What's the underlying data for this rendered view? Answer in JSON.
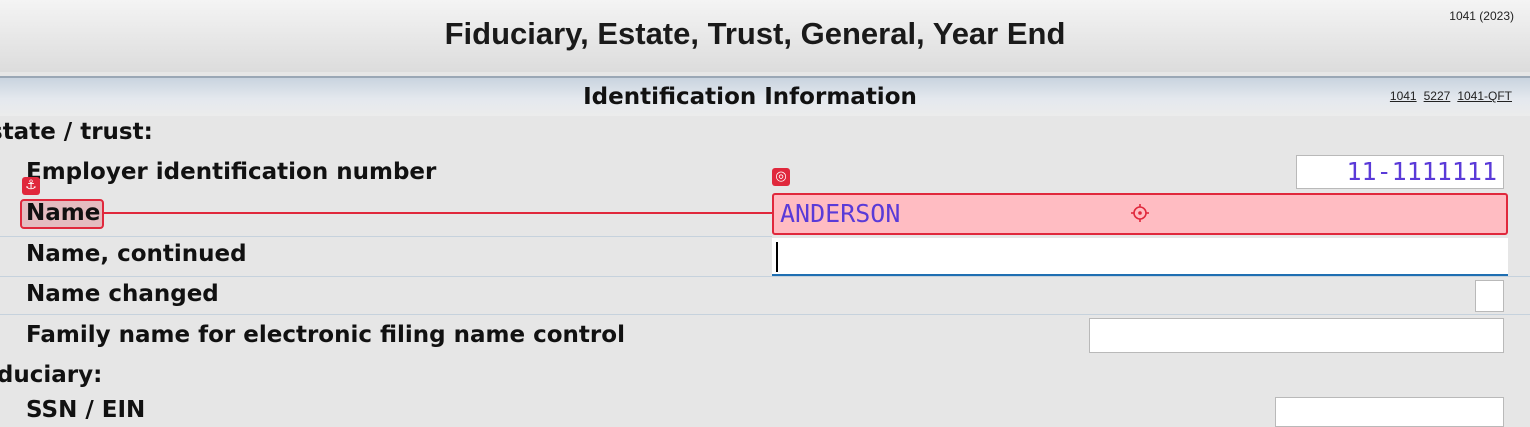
{
  "header": {
    "title": "Fiduciary, Estate, Trust, General, Year End",
    "form_code": "1041 (2023)"
  },
  "section": {
    "title": "Identification Information",
    "links": [
      "1041",
      "5227",
      "1041-QFT"
    ]
  },
  "labels": {
    "estate_trust": "state / trust:",
    "ein": "Employer identification number",
    "name": "Name",
    "name_continued": "Name, continued",
    "name_changed": "Name changed",
    "family_name": "Family name for electronic filing name control",
    "fiduciary": "iduciary:",
    "ssn_ein": "SSN / EIN"
  },
  "fields": {
    "ein": "11-1111111",
    "name": "ANDERSON",
    "name_continued": "",
    "family_name": "",
    "ssn_ein": ""
  },
  "colors": {
    "accent_red": "#e0283c",
    "value_text": "#5a3ad8",
    "focus_blue": "#1f6fb2"
  },
  "icons": {
    "anchor": "anchor-icon",
    "field_target": "target-icon",
    "crosshair": "crosshair-icon"
  }
}
